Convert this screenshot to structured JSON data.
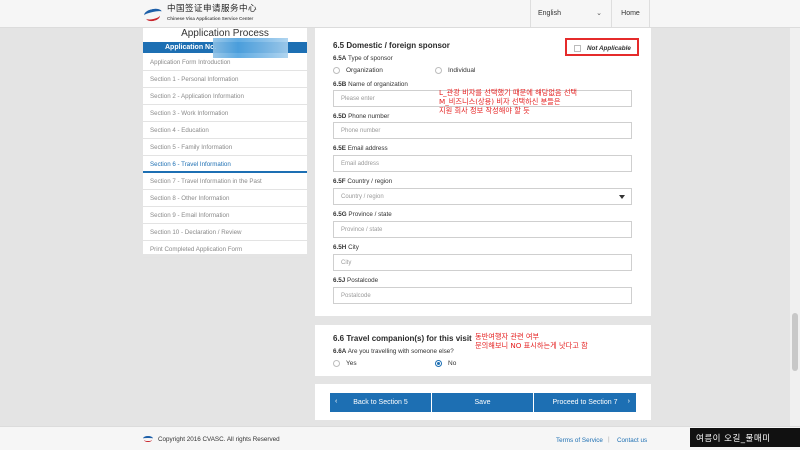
{
  "header": {
    "logo_cn": "中国签证申请服务中心",
    "logo_en": "Chinese Visa Application Service Center",
    "language": "English",
    "home": "Home"
  },
  "sidebar": {
    "title": "Application Process",
    "app_no_label": "Application No.",
    "items": [
      "Application Form Introduction",
      "Section 1 - Personal Information",
      "Section 2 - Application Information",
      "Section 3 - Work Information",
      "Section 4 - Education",
      "Section 5 - Family Information",
      "Section 6 - Travel Information",
      "Section 7 - Travel Information in the Past",
      "Section 8 - Other Information",
      "Section 9 - Email Information",
      "Section 10 - Declaration / Review",
      "Print Completed Application Form"
    ],
    "active_index": 6
  },
  "sponsor": {
    "title": "6.5 Domestic / foreign sponsor",
    "not_applicable": "Not Applicable",
    "type_num": "6.5A",
    "type_text": "Type of sponsor",
    "opt_org": "Organization",
    "opt_ind": "Individual",
    "name_num": "6.5B",
    "name_text": "Name of organization",
    "name_placeholder": "Please enter",
    "phone_num": "6.5D",
    "phone_text": "Phone number",
    "phone_placeholder": "Phone number",
    "email_num": "6.5E",
    "email_text": "Email address",
    "email_placeholder": "Email address",
    "country_num": "6.5F",
    "country_text": "Country / region",
    "country_placeholder": "Country / region",
    "province_num": "6.5G",
    "province_text": "Province / state",
    "province_placeholder": "Province / state",
    "city_num": "6.5H",
    "city_text": "City",
    "city_placeholder": "City",
    "postal_num": "6.5J",
    "postal_text": "Postalcode",
    "postal_placeholder": "Postalcode"
  },
  "annotation1": {
    "line1": "L_관광 비자를 선택했기 때문에 해당없음 선택",
    "line2": "M_비즈니스(상용) 비자 선택하신 분들은",
    "line3": "지원 회사 정보 작성해야 할 듯"
  },
  "companion": {
    "title": "6.6 Travel companion(s) for this visit",
    "q_num": "6.6A",
    "q_text": "Are you travelling with someone else?",
    "yes": "Yes",
    "no": "No",
    "selected": "No"
  },
  "annotation2": {
    "line1": "동반여행자 관련 여부",
    "line2": "문의해보니 NO 표시하는게 낫다고 함"
  },
  "nav": {
    "back": "Back to Section 5",
    "save": "Save",
    "proceed": "Proceed to Section 7"
  },
  "footer": {
    "copyright": "Copyright 2016 CVASC. All rights Reserved",
    "terms": "Terms of Service",
    "separator": "|",
    "contact": "Contact us",
    "watermark": "여름이 오길_물매미"
  },
  "colors": {
    "primary": "#1d6fb3",
    "annotation": "#e52222",
    "background": "#e4e4e4"
  }
}
